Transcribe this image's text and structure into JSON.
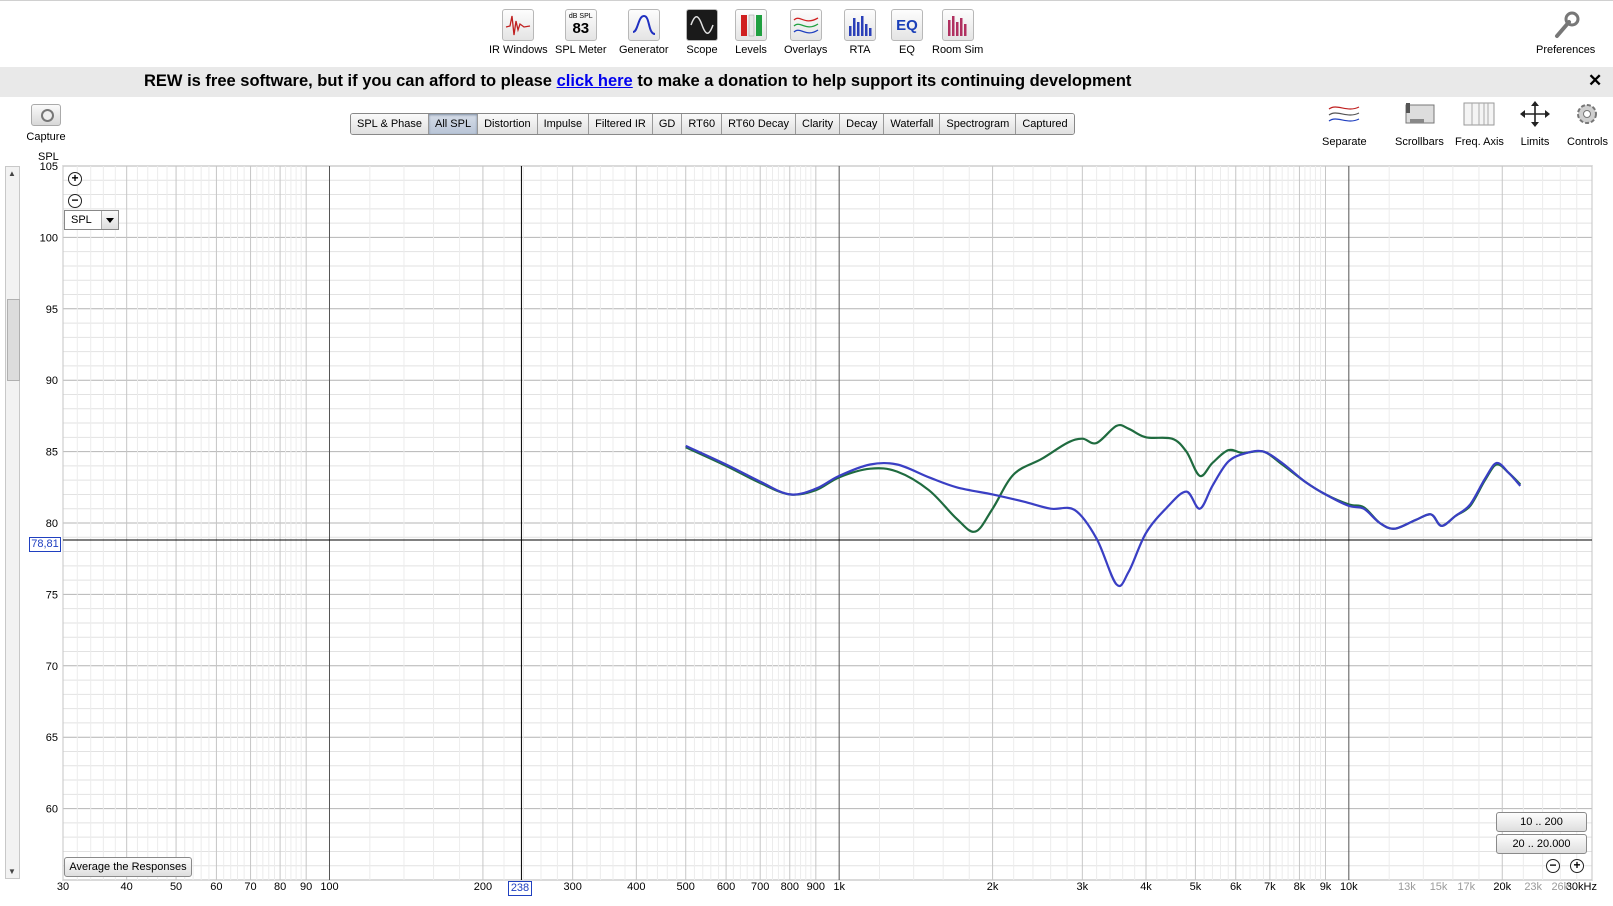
{
  "toolbar": {
    "tools": [
      {
        "label": "IR Windows",
        "icon": "ir-windows-icon"
      },
      {
        "label": "SPL Meter",
        "icon": "spl-meter-icon",
        "meter_unit": "dB SPL",
        "meter_value": "83"
      },
      {
        "label": "Generator",
        "icon": "generator-icon"
      },
      {
        "label": "Scope",
        "icon": "scope-icon"
      },
      {
        "label": "Levels",
        "icon": "levels-icon"
      },
      {
        "label": "Overlays",
        "icon": "overlays-icon"
      },
      {
        "label": "RTA",
        "icon": "rta-icon"
      },
      {
        "label": "EQ",
        "icon": "eq-icon",
        "icon_text": "EQ"
      },
      {
        "label": "Room Sim",
        "icon": "room-sim-icon"
      }
    ],
    "preferences_label": "Preferences"
  },
  "banner": {
    "text_before": "REW is free software, but if you can afford to please",
    "link_text": "click here",
    "text_after": "to make a donation to help support its continuing development",
    "close_glyph": "✕"
  },
  "capture_label": "Capture",
  "tabs": [
    "SPL & Phase",
    "All SPL",
    "Distortion",
    "Impulse",
    "Filtered IR",
    "GD",
    "RT60",
    "RT60 Decay",
    "Clarity",
    "Decay",
    "Waterfall",
    "Spectrogram",
    "Captured"
  ],
  "active_tab": "All SPL",
  "right_tools": [
    {
      "label": "Separate",
      "icon": "separate-icon"
    },
    {
      "label": "Scrollbars",
      "icon": "scrollbars-icon"
    },
    {
      "label": "Freq. Axis",
      "icon": "freq-axis-icon"
    },
    {
      "label": "Limits",
      "icon": "limits-icon"
    },
    {
      "label": "Controls",
      "icon": "controls-icon"
    }
  ],
  "graph": {
    "y_unit": "SPL",
    "spl_select": "SPL",
    "avg_button": "Average the Responses",
    "range_buttons": [
      "10 .. 200",
      "20 .. 20.000"
    ],
    "cursor_y": "78,81",
    "cursor_x": "238"
  },
  "chart_data": {
    "type": "line",
    "xscale": "log",
    "xlim": [
      30,
      30000
    ],
    "ylim": [
      55,
      105
    ],
    "y_ticks": [
      105,
      100,
      95,
      90,
      85,
      80,
      75,
      70,
      65,
      60
    ],
    "x_ticks": [
      {
        "value": 30,
        "label": "30"
      },
      {
        "value": 40,
        "label": "40"
      },
      {
        "value": 50,
        "label": "50"
      },
      {
        "value": 60,
        "label": "60"
      },
      {
        "value": 70,
        "label": "70"
      },
      {
        "value": 80,
        "label": "80"
      },
      {
        "value": 90,
        "label": "90"
      },
      {
        "value": 100,
        "label": "100"
      },
      {
        "value": 200,
        "label": "200"
      },
      {
        "value": 300,
        "label": "300"
      },
      {
        "value": 400,
        "label": "400"
      },
      {
        "value": 500,
        "label": "500"
      },
      {
        "value": 600,
        "label": "600"
      },
      {
        "value": 700,
        "label": "700"
      },
      {
        "value": 800,
        "label": "800"
      },
      {
        "value": 900,
        "label": "900"
      },
      {
        "value": 1000,
        "label": "1k"
      },
      {
        "value": 2000,
        "label": "2k"
      },
      {
        "value": 3000,
        "label": "3k"
      },
      {
        "value": 4000,
        "label": "4k"
      },
      {
        "value": 5000,
        "label": "5k"
      },
      {
        "value": 6000,
        "label": "6k"
      },
      {
        "value": 7000,
        "label": "7k"
      },
      {
        "value": 8000,
        "label": "8k"
      },
      {
        "value": 9000,
        "label": "9k"
      },
      {
        "value": 10000,
        "label": "10k"
      },
      {
        "value": 13000,
        "label": "13k",
        "grey": true
      },
      {
        "value": 15000,
        "label": "15k",
        "grey": true
      },
      {
        "value": 17000,
        "label": "17k",
        "grey": true
      },
      {
        "value": 20000,
        "label": "20k"
      },
      {
        "value": 23000,
        "label": "23k",
        "grey": true
      },
      {
        "value": 26000,
        "label": "26k",
        "grey": true
      },
      {
        "value": 30000,
        "label": "30kHz"
      }
    ],
    "cursor": {
      "x": 238,
      "y": 78.81
    },
    "series": [
      {
        "color": "#1f6b3f",
        "points": [
          [
            500,
            85.3
          ],
          [
            600,
            84
          ],
          [
            700,
            82.8
          ],
          [
            800,
            82
          ],
          [
            900,
            82.3
          ],
          [
            1000,
            83.2
          ],
          [
            1150,
            83.8
          ],
          [
            1300,
            83.6
          ],
          [
            1500,
            82.3
          ],
          [
            1700,
            80.3
          ],
          [
            1850,
            79.4
          ],
          [
            2000,
            81
          ],
          [
            2200,
            83.4
          ],
          [
            2500,
            84.5
          ],
          [
            2800,
            85.6
          ],
          [
            3000,
            85.9
          ],
          [
            3200,
            85.6
          ],
          [
            3500,
            86.8
          ],
          [
            3700,
            86.6
          ],
          [
            4000,
            86
          ],
          [
            4500,
            85.9
          ],
          [
            4800,
            85
          ],
          [
            5100,
            83.3
          ],
          [
            5400,
            84.2
          ],
          [
            5800,
            85.1
          ],
          [
            6200,
            84.9
          ],
          [
            6800,
            85
          ],
          [
            7400,
            84.1
          ],
          [
            8200,
            82.9
          ],
          [
            9000,
            82
          ],
          [
            10000,
            81.3
          ],
          [
            10700,
            81.1
          ],
          [
            11500,
            80
          ],
          [
            12300,
            79.6
          ],
          [
            13500,
            80.2
          ],
          [
            14500,
            80.6
          ],
          [
            15200,
            79.8
          ],
          [
            16200,
            80.5
          ],
          [
            17300,
            81.2
          ],
          [
            18500,
            83
          ],
          [
            19500,
            84.1
          ],
          [
            20600,
            83.5
          ],
          [
            21700,
            82.7
          ]
        ]
      },
      {
        "color": "#3a3fc4",
        "points": [
          [
            500,
            85.4
          ],
          [
            600,
            84.1
          ],
          [
            700,
            82.9
          ],
          [
            800,
            82
          ],
          [
            900,
            82.4
          ],
          [
            1000,
            83.3
          ],
          [
            1150,
            84.1
          ],
          [
            1300,
            84.1
          ],
          [
            1500,
            83.2
          ],
          [
            1700,
            82.5
          ],
          [
            2000,
            82
          ],
          [
            2300,
            81.5
          ],
          [
            2600,
            81
          ],
          [
            2900,
            80.9
          ],
          [
            3200,
            78.9
          ],
          [
            3500,
            75.7
          ],
          [
            3700,
            76.6
          ],
          [
            4000,
            79.3
          ],
          [
            4400,
            81.1
          ],
          [
            4800,
            82.2
          ],
          [
            5100,
            81
          ],
          [
            5400,
            82.6
          ],
          [
            5800,
            84.3
          ],
          [
            6300,
            84.9
          ],
          [
            6800,
            85
          ],
          [
            7400,
            84.2
          ],
          [
            8200,
            82.9
          ],
          [
            9000,
            82
          ],
          [
            10000,
            81.2
          ],
          [
            10700,
            81
          ],
          [
            11500,
            80
          ],
          [
            12300,
            79.6
          ],
          [
            13500,
            80.2
          ],
          [
            14500,
            80.6
          ],
          [
            15200,
            79.8
          ],
          [
            16200,
            80.5
          ],
          [
            17300,
            81.3
          ],
          [
            18500,
            83.1
          ],
          [
            19500,
            84.2
          ],
          [
            20600,
            83.5
          ],
          [
            21700,
            82.6
          ]
        ]
      }
    ]
  }
}
